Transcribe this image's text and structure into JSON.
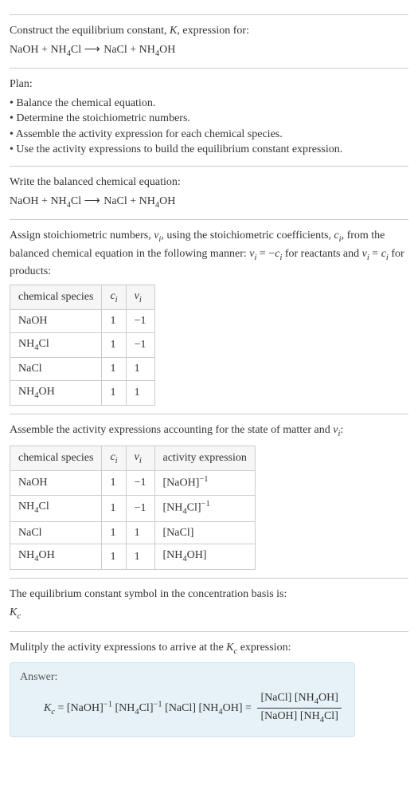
{
  "intro": {
    "line1": "Construct the equilibrium constant, K, expression for:",
    "equation": "NaOH + NH₄Cl ⟶ NaCl + NH₄OH"
  },
  "plan": {
    "heading": "Plan:",
    "items": [
      "Balance the chemical equation.",
      "Determine the stoichiometric numbers.",
      "Assemble the activity expression for each chemical species.",
      "Use the activity expressions to build the equilibrium constant expression."
    ]
  },
  "balanced": {
    "heading": "Write the balanced chemical equation:",
    "equation": "NaOH + NH₄Cl ⟶ NaCl + NH₄OH"
  },
  "stoich": {
    "text": "Assign stoichiometric numbers, νᵢ, using the stoichiometric coefficients, cᵢ, from the balanced chemical equation in the following manner: νᵢ = −cᵢ for reactants and νᵢ = cᵢ for products:",
    "headers": [
      "chemical species",
      "cᵢ",
      "νᵢ"
    ],
    "rows": [
      {
        "species": "NaOH",
        "c": "1",
        "v": "−1"
      },
      {
        "species": "NH₄Cl",
        "c": "1",
        "v": "−1"
      },
      {
        "species": "NaCl",
        "c": "1",
        "v": "1"
      },
      {
        "species": "NH₄OH",
        "c": "1",
        "v": "1"
      }
    ]
  },
  "activity": {
    "text": "Assemble the activity expressions accounting for the state of matter and νᵢ:",
    "headers": [
      "chemical species",
      "cᵢ",
      "νᵢ",
      "activity expression"
    ],
    "rows": [
      {
        "species": "NaOH",
        "c": "1",
        "v": "−1",
        "expr": "[NaOH]⁻¹"
      },
      {
        "species": "NH₄Cl",
        "c": "1",
        "v": "−1",
        "expr": "[NH₄Cl]⁻¹"
      },
      {
        "species": "NaCl",
        "c": "1",
        "v": "1",
        "expr": "[NaCl]"
      },
      {
        "species": "NH₄OH",
        "c": "1",
        "v": "1",
        "expr": "[NH₄OH]"
      }
    ]
  },
  "symbol": {
    "text": "The equilibrium constant symbol in the concentration basis is:",
    "sym": "K꜀"
  },
  "final": {
    "text": "Mulitply the activity expressions to arrive at the K꜀ expression:",
    "answer_label": "Answer:",
    "lhs": "K꜀ = [NaOH]⁻¹ [NH₄Cl]⁻¹ [NaCl] [NH₄OH] =",
    "numerator": "[NaCl] [NH₄OH]",
    "denominator": "[NaOH] [NH₄Cl]"
  }
}
